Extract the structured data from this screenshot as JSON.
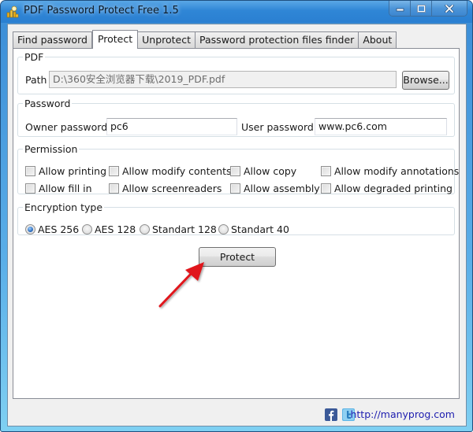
{
  "window": {
    "title": "PDF Password Protect Free 1.5",
    "caption_buttons": [
      "minimize",
      "maximize",
      "close"
    ]
  },
  "tabs": [
    {
      "label": "Find password",
      "active": false
    },
    {
      "label": "Protect",
      "active": true
    },
    {
      "label": "Unprotect",
      "active": false
    },
    {
      "label": "Password protection files finder",
      "active": false
    },
    {
      "label": "About",
      "active": false
    }
  ],
  "pdf_group": {
    "legend": "PDF",
    "path_label": "Path",
    "path_value": "D:\\360安全浏览器下载\\2019_PDF.pdf",
    "browse_label": "Browse..."
  },
  "password_group": {
    "legend": "Password",
    "owner_label": "Owner password",
    "owner_value": "pc6",
    "user_label": "User password",
    "user_value": "www.pc6.com"
  },
  "permission_group": {
    "legend": "Permission",
    "items": [
      {
        "label": "Allow printing",
        "checked": false
      },
      {
        "label": "Allow modify contents",
        "checked": false
      },
      {
        "label": "Allow copy",
        "checked": false
      },
      {
        "label": "Allow modify annotations",
        "checked": false
      },
      {
        "label": "Allow fill in",
        "checked": false
      },
      {
        "label": "Allow screenreaders",
        "checked": false
      },
      {
        "label": "Allow assembly",
        "checked": false
      },
      {
        "label": "Allow degraded printing",
        "checked": false
      }
    ]
  },
  "encryption_group": {
    "legend": "Encryption type",
    "options": [
      {
        "label": "AES 256",
        "selected": true
      },
      {
        "label": "AES 128",
        "selected": false
      },
      {
        "label": "Standart 128",
        "selected": false
      },
      {
        "label": "Standart 40",
        "selected": false
      }
    ]
  },
  "protect_button": "Protect",
  "annotation": {
    "arrow_color": "#e0161b",
    "points_to": "protect_button"
  },
  "footer": {
    "facebook_icon": "facebook-icon",
    "twitter_icon": "twitter-icon",
    "link_text": "http://manyprog.com",
    "link_color": "#2020b0"
  }
}
